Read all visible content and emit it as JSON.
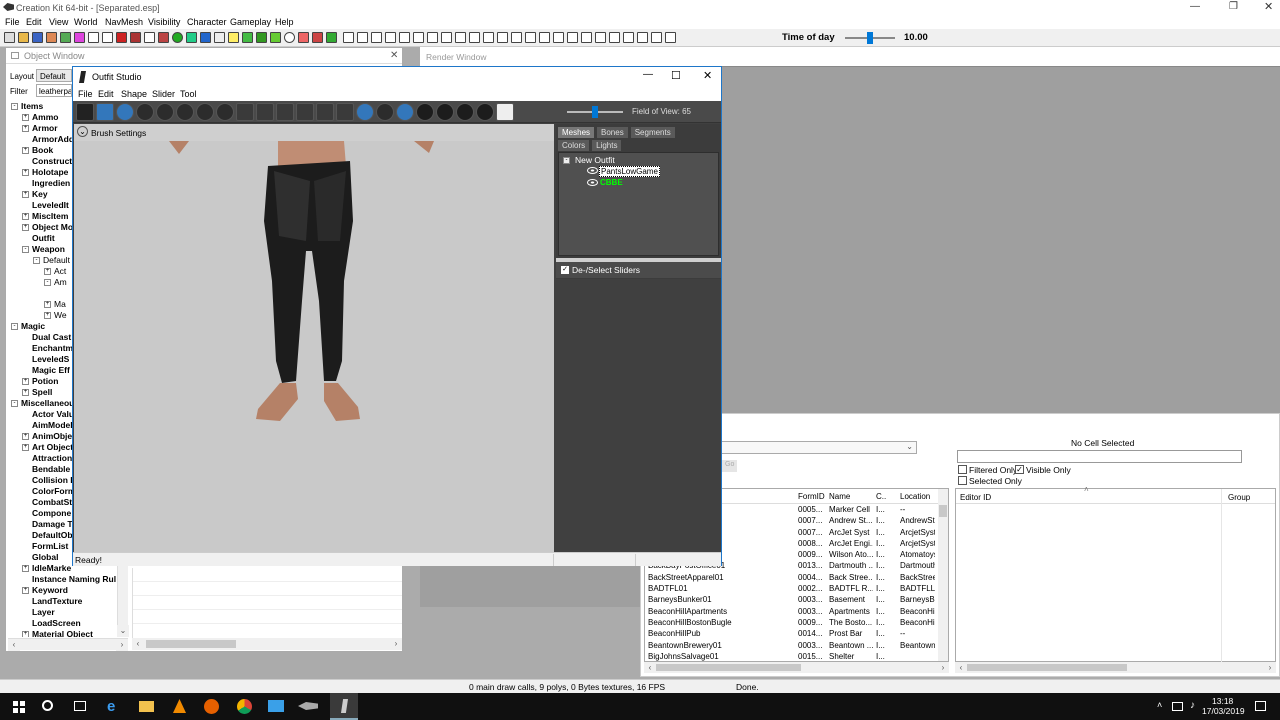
{
  "app": {
    "title": "Creation Kit 64-bit - [Separated.esp]",
    "menu": [
      "File",
      "Edit",
      "View",
      "World",
      "NavMesh",
      "Visibility",
      "Character",
      "Gameplay",
      "Help"
    ],
    "time_of_day_label": "Time of day",
    "time_of_day_value": "10.00",
    "time_of_day_level": 0.5
  },
  "object_window": {
    "title": "Object Window",
    "layout_label": "Layout",
    "layout_value": "Default",
    "filter_label": "Filter",
    "filter_value": "leatherpa",
    "tree": [
      {
        "label": "Items",
        "depth": 0,
        "exp": "-"
      },
      {
        "label": "Ammo",
        "depth": 1,
        "exp": "+"
      },
      {
        "label": "Armor",
        "depth": 1,
        "exp": "+"
      },
      {
        "label": "ArmorAdd",
        "depth": 1,
        "exp": ""
      },
      {
        "label": "Book",
        "depth": 1,
        "exp": "+"
      },
      {
        "label": "Construct",
        "depth": 1,
        "exp": ""
      },
      {
        "label": "Holotape",
        "depth": 1,
        "exp": "+"
      },
      {
        "label": "Ingredien",
        "depth": 1,
        "exp": ""
      },
      {
        "label": "Key",
        "depth": 1,
        "exp": "+"
      },
      {
        "label": "LeveledIt",
        "depth": 1,
        "exp": ""
      },
      {
        "label": "MiscItem",
        "depth": 1,
        "exp": "+"
      },
      {
        "label": "Object Mo",
        "depth": 1,
        "exp": "+"
      },
      {
        "label": "Outfit",
        "depth": 1,
        "exp": ""
      },
      {
        "label": "Weapon",
        "depth": 1,
        "exp": "-"
      },
      {
        "label": "Default",
        "depth": 2,
        "exp": "-"
      },
      {
        "label": "Act",
        "depth": 3,
        "exp": "+"
      },
      {
        "label": "Am",
        "depth": 3,
        "exp": "-"
      },
      {
        "label": "",
        "depth": 4,
        "exp": ""
      },
      {
        "label": "Ma",
        "depth": 3,
        "exp": "+"
      },
      {
        "label": "We",
        "depth": 3,
        "exp": "+"
      },
      {
        "label": "Magic",
        "depth": 0,
        "exp": "-"
      },
      {
        "label": "Dual Cast",
        "depth": 1,
        "exp": ""
      },
      {
        "label": "Enchantm",
        "depth": 1,
        "exp": ""
      },
      {
        "label": "LeveledS",
        "depth": 1,
        "exp": ""
      },
      {
        "label": "Magic Eff",
        "depth": 1,
        "exp": ""
      },
      {
        "label": "Potion",
        "depth": 1,
        "exp": "+"
      },
      {
        "label": "Spell",
        "depth": 1,
        "exp": "+"
      },
      {
        "label": "Miscellaneou",
        "depth": 0,
        "exp": "-"
      },
      {
        "label": "Actor Valu",
        "depth": 1,
        "exp": ""
      },
      {
        "label": "AimModel",
        "depth": 1,
        "exp": ""
      },
      {
        "label": "AnimObje",
        "depth": 1,
        "exp": "+"
      },
      {
        "label": "Art Object",
        "depth": 1,
        "exp": "+"
      },
      {
        "label": "Attraction",
        "depth": 1,
        "exp": ""
      },
      {
        "label": "Bendable",
        "depth": 1,
        "exp": ""
      },
      {
        "label": "Collision I",
        "depth": 1,
        "exp": ""
      },
      {
        "label": "ColorForm",
        "depth": 1,
        "exp": ""
      },
      {
        "label": "CombatSt",
        "depth": 1,
        "exp": ""
      },
      {
        "label": "Compone",
        "depth": 1,
        "exp": ""
      },
      {
        "label": "Damage T",
        "depth": 1,
        "exp": ""
      },
      {
        "label": "DefaultOb",
        "depth": 1,
        "exp": ""
      },
      {
        "label": "FormList",
        "depth": 1,
        "exp": ""
      },
      {
        "label": "Global",
        "depth": 1,
        "exp": ""
      },
      {
        "label": "IdleMarke",
        "depth": 1,
        "exp": "+"
      },
      {
        "label": "Instance Naming Rul",
        "depth": 1,
        "exp": ""
      },
      {
        "label": "Keyword",
        "depth": 1,
        "exp": "+"
      },
      {
        "label": "LandTexture",
        "depth": 1,
        "exp": ""
      },
      {
        "label": "Layer",
        "depth": 1,
        "exp": ""
      },
      {
        "label": "LoadScreen",
        "depth": 1,
        "exp": ""
      },
      {
        "label": "Material Object",
        "depth": 1,
        "exp": "+"
      }
    ]
  },
  "render_window": {
    "title": "Render Window"
  },
  "outfit_studio": {
    "title": "Outfit Studio",
    "menu": [
      "File",
      "Edit",
      "Shape",
      "Slider",
      "Tool"
    ],
    "fov_label": "Field of View: 65",
    "fov_level": 0.5,
    "brush_settings": "Brush Settings",
    "tabs_row1": [
      "Meshes",
      "Bones",
      "Segments"
    ],
    "tabs_row2": [
      "Colors",
      "Lights"
    ],
    "tree_root": "New Outfit",
    "meshes": [
      {
        "name": "PantsLowGame",
        "color": "#000000",
        "bg": "#ffffff"
      },
      {
        "name": "CBBE",
        "color": "#00ff00",
        "bg": "transparent"
      }
    ],
    "sliders_label": "De-/Select Sliders",
    "status": "Ready!"
  },
  "cell_view": {
    "no_cell": "No Cell Selected",
    "go": "Go",
    "filtered_only": "Filtered Only",
    "visible_only": "Visible Only",
    "selected_only": "Selected Only",
    "left_columns": [
      "",
      "FormID",
      "Name",
      "C..",
      "Location"
    ],
    "left_rows": [
      [
        "",
        "0005...",
        "Marker Cell",
        "I...",
        "--"
      ],
      [
        "",
        "0007...",
        "Andrew St...",
        "I...",
        "AndrewSta"
      ],
      [
        "",
        "0007...",
        "ArcJet Syst",
        "I...",
        "ArcjetSyste"
      ],
      [
        "",
        "0008...",
        "ArcJet Engi...",
        "I...",
        "ArcjetSyste"
      ],
      [
        "01",
        "0009...",
        "Wilson Ato...",
        "I...",
        "Atomatoys"
      ],
      [
        "BackBayPostOffice01",
        "0013...",
        "Dartmouth ...",
        "I...",
        "Dartmouth"
      ],
      [
        "BackStreetApparel01",
        "0004...",
        "Back Stree...",
        "I...",
        "BackStree"
      ],
      [
        "BADTFL01",
        "0002...",
        "BADTFL R...",
        "I...",
        "BADTFLLo"
      ],
      [
        "BarneysBunker01",
        "0003...",
        "Basement",
        "I...",
        "BarneysBu"
      ],
      [
        "BeaconHillApartments",
        "0003...",
        "Apartments",
        "I...",
        "BeaconHill"
      ],
      [
        "BeaconHillBostonBugle",
        "0009...",
        "The Bosto...",
        "I...",
        "BeaconHill"
      ],
      [
        "BeaconHillPub",
        "0014...",
        "Prost Bar",
        "I...",
        "--"
      ],
      [
        "BeantownBrewery01",
        "0003...",
        "Beantown ...",
        "I...",
        "Beantown"
      ],
      [
        "BigJohnsSalvage01",
        "0015...",
        "Shelter",
        "I...",
        ""
      ]
    ],
    "right_columns": [
      "Editor ID",
      "Group"
    ]
  },
  "status_bar": {
    "draw_calls": "0 main draw calls, 9 polys, 0 Bytes textures, 16 FPS",
    "done": "Done."
  },
  "taskbar": {
    "time": "13:18",
    "date": "17/03/2019"
  },
  "colors": {
    "os_bg": "#404040",
    "os_viewport": "#c9c9c9",
    "taskbar": "#101010",
    "accent_blue": "#0078d7"
  }
}
